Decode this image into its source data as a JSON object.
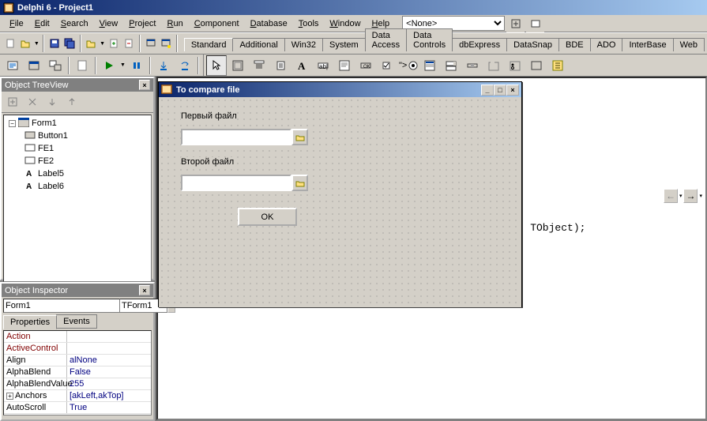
{
  "title": "Delphi 6 - Project1",
  "menus": [
    "File",
    "Edit",
    "Search",
    "View",
    "Project",
    "Run",
    "Component",
    "Database",
    "Tools",
    "Window",
    "Help"
  ],
  "dropdown": "<None>",
  "component_tabs": [
    "Standard",
    "Additional",
    "Win32",
    "System",
    "Data Access",
    "Data Controls",
    "dbExpress",
    "DataSnap",
    "BDE",
    "ADO",
    "InterBase",
    "Web"
  ],
  "treeview": {
    "title": "Object TreeView",
    "root": "Form1",
    "children": [
      "Button1",
      "FE1",
      "FE2",
      "Label5",
      "Label6"
    ]
  },
  "inspector": {
    "title": "Object Inspector",
    "object_name": "Form1",
    "object_type": "TForm1",
    "tabs": [
      "Properties",
      "Events"
    ],
    "props": [
      {
        "name": "Action",
        "value": "",
        "red": true
      },
      {
        "name": "ActiveControl",
        "value": "",
        "red": true
      },
      {
        "name": "Align",
        "value": "alNone"
      },
      {
        "name": "AlphaBlend",
        "value": "False"
      },
      {
        "name": "AlphaBlendValue",
        "value": "255"
      },
      {
        "name": "Anchors",
        "value": "[akLeft,akTop]",
        "expand": true
      },
      {
        "name": "AutoScroll",
        "value": "True"
      }
    ]
  },
  "form": {
    "title": "To compare file",
    "label1": "Первый файл",
    "label2": "Второй файл",
    "ok": "OK"
  },
  "code_snippet": "er: TObject);"
}
